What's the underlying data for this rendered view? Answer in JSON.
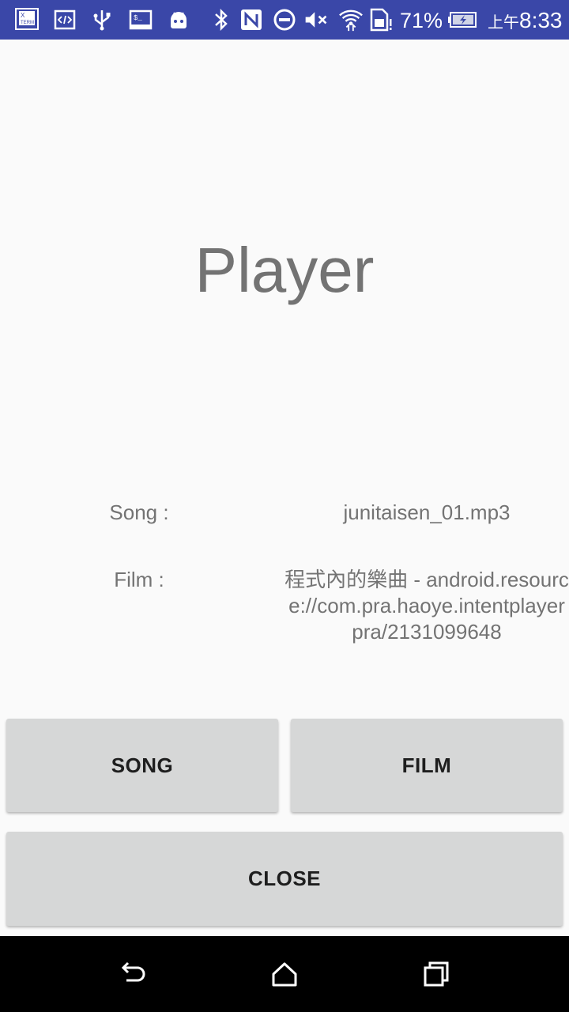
{
  "status_bar": {
    "background_color": "#3a47a8",
    "icons": [
      "xterm-icon",
      "code-icon",
      "usb-icon",
      "terminal-icon",
      "android-icon",
      "bluetooth-icon",
      "nfc-icon",
      "do-not-disturb-icon",
      "mute-icon",
      "wifi-icon",
      "sim-icon",
      "battery-charging-icon"
    ],
    "battery_percent": "71%",
    "ampm": "上午",
    "time": "8:33"
  },
  "main": {
    "title": "Player",
    "song": {
      "label": "Song :",
      "value": "junitaisen_01.mp3"
    },
    "film": {
      "label": "Film :",
      "value": "程式內的樂曲 - android.resource://com.pra.haoye.intentplayerpra/2131099648"
    }
  },
  "buttons": {
    "song_label": "SONG",
    "film_label": "FILM",
    "close_label": "CLOSE"
  },
  "nav_bar": {
    "icons": [
      "back-icon",
      "home-icon",
      "recents-icon"
    ]
  }
}
